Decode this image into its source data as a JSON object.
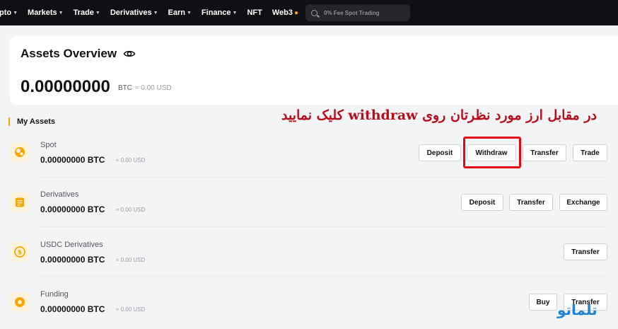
{
  "nav": {
    "items": [
      "pto",
      "Markets",
      "Trade",
      "Derivatives",
      "Earn",
      "Finance",
      "NFT",
      "Web3"
    ],
    "search_placeholder": "0% Fee Spot Trading"
  },
  "overview": {
    "title": "Assets Overview",
    "amount": "0.00000000",
    "unit": "BTC",
    "usd": "≈ 0.00 USD"
  },
  "my_assets": {
    "label": "My Assets"
  },
  "annotation": {
    "text": "در مقابل ارز مورد نظرتان روی withdraw کلیک نمایید"
  },
  "assets": [
    {
      "name": "Spot",
      "amount": "0.00000000 BTC",
      "usd": "≈ 0.00 USD",
      "icon": "spot-coin-icon",
      "buttons": [
        "Deposit",
        "Withdraw",
        "Transfer",
        "Trade"
      ]
    },
    {
      "name": "Derivatives",
      "amount": "0.00000000 BTC",
      "usd": "≈ 0.00 USD",
      "icon": "derivatives-icon",
      "buttons": [
        "Deposit",
        "Transfer",
        "Exchange"
      ]
    },
    {
      "name": "USDC Derivatives",
      "amount": "0.00000000 BTC",
      "usd": "≈ 0.00 USD",
      "icon": "usdc-dollar-icon",
      "buttons": [
        "Transfer"
      ]
    },
    {
      "name": "Funding",
      "amount": "0.00000000 BTC",
      "usd": "≈ 0.00 USD",
      "icon": "funding-coin-icon",
      "buttons": [
        "Buy",
        "Transfer"
      ]
    }
  ],
  "watermark": {
    "text": "تلماتو"
  },
  "colors": {
    "accent": "#f7a600",
    "nav_bg": "#101014",
    "highlight": "#e30613",
    "annotation": "#b80d1b",
    "watermark": "#1e82d7"
  }
}
